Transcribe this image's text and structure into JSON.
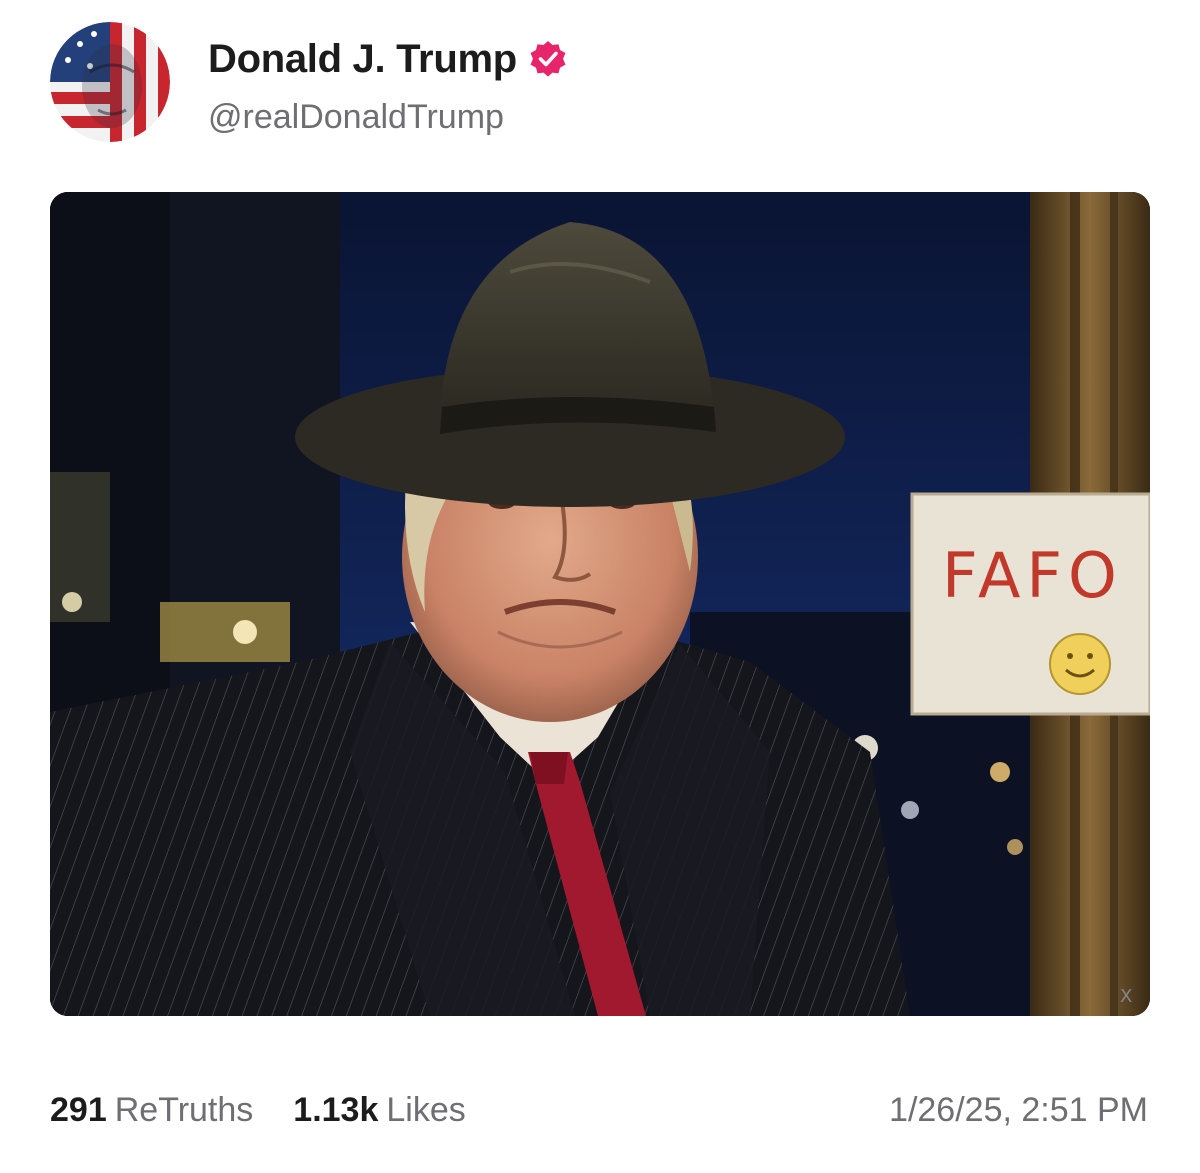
{
  "post": {
    "author": {
      "display_name": "Donald J. Trump",
      "handle": "@realDonaldTrump",
      "verified": true,
      "verified_badge_color": "#e8246b"
    },
    "media": {
      "sign_text": "FAFO",
      "watermark_text": "X"
    },
    "stats": {
      "retruths_count": "291",
      "retruths_label": "ReTruths",
      "likes_count": "1.13k",
      "likes_label": "Likes"
    },
    "timestamp": "1/26/25, 2:51 PM"
  },
  "colors": {
    "accent": "#e8246b",
    "secondary_text": "#6e6e73",
    "primary_text": "#1c1c1c"
  }
}
